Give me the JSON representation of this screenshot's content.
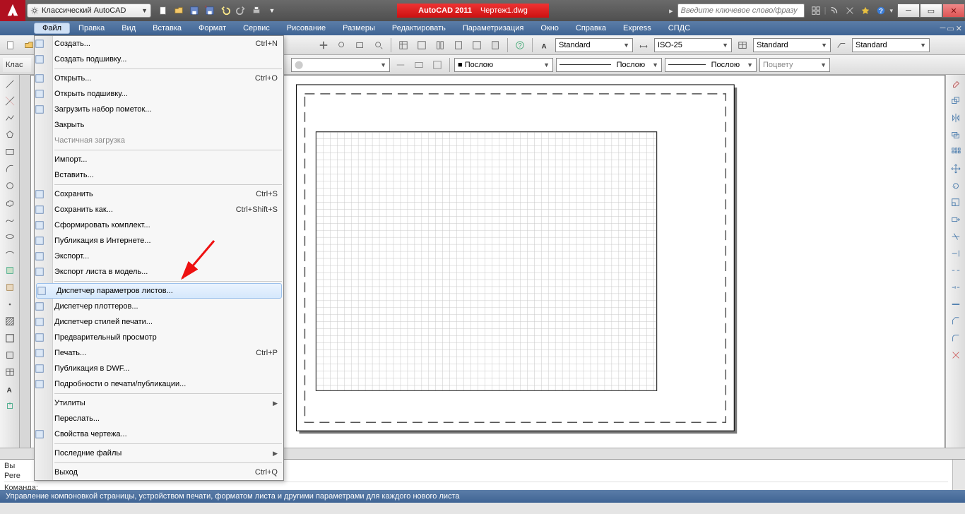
{
  "title": {
    "app": "AutoCAD 2011",
    "file": "Чертеж1.dwg"
  },
  "workspace": "Классический AutoCAD",
  "search_placeholder": "Введите ключевое слово/фразу",
  "menubar": [
    "Файл",
    "Правка",
    "Вид",
    "Вставка",
    "Формат",
    "Сервис",
    "Рисование",
    "Размеры",
    "Редактировать",
    "Параметризация",
    "Окно",
    "Справка",
    "Express",
    "СПДС"
  ],
  "property_bar": {
    "text_style": "Standard",
    "dim_style": "ISO-25",
    "table_style": "Standard",
    "mleader_style": "Standard",
    "layer_label": "Клас",
    "color": "■ Послою",
    "linetype": "Послою",
    "lineweight": "Послою",
    "plotstyle": "Поцвету"
  },
  "file_menu": {
    "items": [
      {
        "label": "Создать...",
        "sc": "Ctrl+N",
        "icon": "file-new"
      },
      {
        "label": "Создать подшивку...",
        "icon": "sheet-new"
      },
      {
        "sep": true
      },
      {
        "label": "Открыть...",
        "sc": "Ctrl+O",
        "icon": "folder-open"
      },
      {
        "label": "Открыть подшивку...",
        "icon": "sheet-open"
      },
      {
        "label": "Загрузить набор пометок...",
        "icon": "markup-load"
      },
      {
        "label": "Закрыть"
      },
      {
        "label": "Частичная загрузка",
        "disabled": true
      },
      {
        "sep": true
      },
      {
        "label": "Импорт..."
      },
      {
        "label": "Вставить..."
      },
      {
        "sep": true
      },
      {
        "label": "Сохранить",
        "sc": "Ctrl+S",
        "icon": "save"
      },
      {
        "label": "Сохранить как...",
        "sc": "Ctrl+Shift+S",
        "icon": "save-as"
      },
      {
        "label": "Сформировать комплект...",
        "icon": "etransmit"
      },
      {
        "label": "Публикация в Интернете...",
        "icon": "publish-web"
      },
      {
        "label": "Экспорт...",
        "icon": "export"
      },
      {
        "label": "Экспорт листа в модель...",
        "icon": "export-layout"
      },
      {
        "sep": true
      },
      {
        "label": "Диспетчер параметров листов...",
        "icon": "page-setup",
        "hl": true
      },
      {
        "label": "Диспетчер плоттеров...",
        "icon": "plotter-mgr"
      },
      {
        "label": "Диспетчер стилей печати...",
        "icon": "plot-style"
      },
      {
        "label": "Предварительный просмотр",
        "icon": "preview"
      },
      {
        "label": "Печать...",
        "sc": "Ctrl+P",
        "icon": "print"
      },
      {
        "label": "Публикация в DWF...",
        "icon": "dwf"
      },
      {
        "label": "Подробности о печати/публикации...",
        "icon": "plot-details"
      },
      {
        "sep": true
      },
      {
        "label": "Утилиты",
        "sub": true
      },
      {
        "label": "Переслать..."
      },
      {
        "label": "Свойства чертежа...",
        "icon": "dwg-props"
      },
      {
        "sep": true
      },
      {
        "label": "Последние файлы",
        "sub": true
      },
      {
        "sep": true
      },
      {
        "label": "Выход",
        "sc": "Ctrl+Q"
      }
    ]
  },
  "cmd": {
    "line1": "Вы",
    "line2": "Реге",
    "prompt": "Команда:"
  },
  "status_hint": "Управление компоновкой страницы, устройством печати, форматом листа и другими параметрами для каждого нового листа"
}
